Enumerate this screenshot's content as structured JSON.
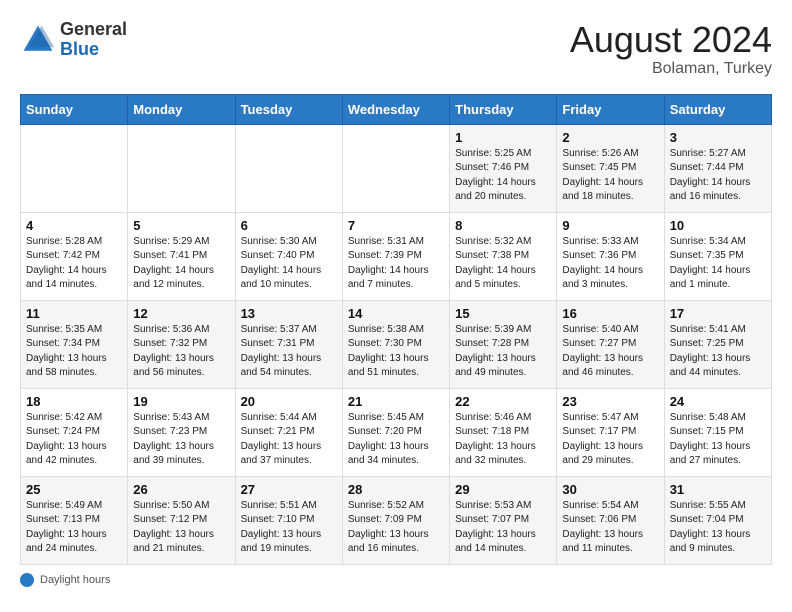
{
  "header": {
    "logo_line1": "General",
    "logo_line2": "Blue",
    "month_year": "August 2024",
    "location": "Bolaman, Turkey"
  },
  "days_of_week": [
    "Sunday",
    "Monday",
    "Tuesday",
    "Wednesday",
    "Thursday",
    "Friday",
    "Saturday"
  ],
  "footer": {
    "label": "Daylight hours"
  },
  "weeks": [
    [
      {
        "day": "",
        "info": ""
      },
      {
        "day": "",
        "info": ""
      },
      {
        "day": "",
        "info": ""
      },
      {
        "day": "",
        "info": ""
      },
      {
        "day": "1",
        "info": "Sunrise: 5:25 AM\nSunset: 7:46 PM\nDaylight: 14 hours\nand 20 minutes."
      },
      {
        "day": "2",
        "info": "Sunrise: 5:26 AM\nSunset: 7:45 PM\nDaylight: 14 hours\nand 18 minutes."
      },
      {
        "day": "3",
        "info": "Sunrise: 5:27 AM\nSunset: 7:44 PM\nDaylight: 14 hours\nand 16 minutes."
      }
    ],
    [
      {
        "day": "4",
        "info": "Sunrise: 5:28 AM\nSunset: 7:42 PM\nDaylight: 14 hours\nand 14 minutes."
      },
      {
        "day": "5",
        "info": "Sunrise: 5:29 AM\nSunset: 7:41 PM\nDaylight: 14 hours\nand 12 minutes."
      },
      {
        "day": "6",
        "info": "Sunrise: 5:30 AM\nSunset: 7:40 PM\nDaylight: 14 hours\nand 10 minutes."
      },
      {
        "day": "7",
        "info": "Sunrise: 5:31 AM\nSunset: 7:39 PM\nDaylight: 14 hours\nand 7 minutes."
      },
      {
        "day": "8",
        "info": "Sunrise: 5:32 AM\nSunset: 7:38 PM\nDaylight: 14 hours\nand 5 minutes."
      },
      {
        "day": "9",
        "info": "Sunrise: 5:33 AM\nSunset: 7:36 PM\nDaylight: 14 hours\nand 3 minutes."
      },
      {
        "day": "10",
        "info": "Sunrise: 5:34 AM\nSunset: 7:35 PM\nDaylight: 14 hours\nand 1 minute."
      }
    ],
    [
      {
        "day": "11",
        "info": "Sunrise: 5:35 AM\nSunset: 7:34 PM\nDaylight: 13 hours\nand 58 minutes."
      },
      {
        "day": "12",
        "info": "Sunrise: 5:36 AM\nSunset: 7:32 PM\nDaylight: 13 hours\nand 56 minutes."
      },
      {
        "day": "13",
        "info": "Sunrise: 5:37 AM\nSunset: 7:31 PM\nDaylight: 13 hours\nand 54 minutes."
      },
      {
        "day": "14",
        "info": "Sunrise: 5:38 AM\nSunset: 7:30 PM\nDaylight: 13 hours\nand 51 minutes."
      },
      {
        "day": "15",
        "info": "Sunrise: 5:39 AM\nSunset: 7:28 PM\nDaylight: 13 hours\nand 49 minutes."
      },
      {
        "day": "16",
        "info": "Sunrise: 5:40 AM\nSunset: 7:27 PM\nDaylight: 13 hours\nand 46 minutes."
      },
      {
        "day": "17",
        "info": "Sunrise: 5:41 AM\nSunset: 7:25 PM\nDaylight: 13 hours\nand 44 minutes."
      }
    ],
    [
      {
        "day": "18",
        "info": "Sunrise: 5:42 AM\nSunset: 7:24 PM\nDaylight: 13 hours\nand 42 minutes."
      },
      {
        "day": "19",
        "info": "Sunrise: 5:43 AM\nSunset: 7:23 PM\nDaylight: 13 hours\nand 39 minutes."
      },
      {
        "day": "20",
        "info": "Sunrise: 5:44 AM\nSunset: 7:21 PM\nDaylight: 13 hours\nand 37 minutes."
      },
      {
        "day": "21",
        "info": "Sunrise: 5:45 AM\nSunset: 7:20 PM\nDaylight: 13 hours\nand 34 minutes."
      },
      {
        "day": "22",
        "info": "Sunrise: 5:46 AM\nSunset: 7:18 PM\nDaylight: 13 hours\nand 32 minutes."
      },
      {
        "day": "23",
        "info": "Sunrise: 5:47 AM\nSunset: 7:17 PM\nDaylight: 13 hours\nand 29 minutes."
      },
      {
        "day": "24",
        "info": "Sunrise: 5:48 AM\nSunset: 7:15 PM\nDaylight: 13 hours\nand 27 minutes."
      }
    ],
    [
      {
        "day": "25",
        "info": "Sunrise: 5:49 AM\nSunset: 7:13 PM\nDaylight: 13 hours\nand 24 minutes."
      },
      {
        "day": "26",
        "info": "Sunrise: 5:50 AM\nSunset: 7:12 PM\nDaylight: 13 hours\nand 21 minutes."
      },
      {
        "day": "27",
        "info": "Sunrise: 5:51 AM\nSunset: 7:10 PM\nDaylight: 13 hours\nand 19 minutes."
      },
      {
        "day": "28",
        "info": "Sunrise: 5:52 AM\nSunset: 7:09 PM\nDaylight: 13 hours\nand 16 minutes."
      },
      {
        "day": "29",
        "info": "Sunrise: 5:53 AM\nSunset: 7:07 PM\nDaylight: 13 hours\nand 14 minutes."
      },
      {
        "day": "30",
        "info": "Sunrise: 5:54 AM\nSunset: 7:06 PM\nDaylight: 13 hours\nand 11 minutes."
      },
      {
        "day": "31",
        "info": "Sunrise: 5:55 AM\nSunset: 7:04 PM\nDaylight: 13 hours\nand 9 minutes."
      }
    ]
  ]
}
